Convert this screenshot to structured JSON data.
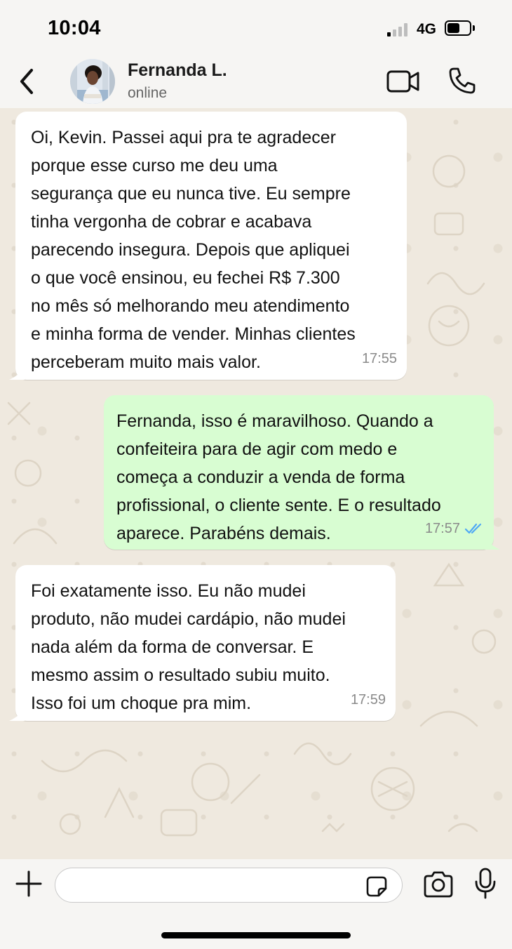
{
  "status_bar": {
    "time": "10:04",
    "network": "4G",
    "battery_level": 0.55
  },
  "header": {
    "contact_name": "Fernanda L.",
    "contact_status": "online",
    "icons": [
      "back-icon",
      "avatar-photo",
      "video-call-icon",
      "phone-icon"
    ]
  },
  "messages": [
    {
      "direction": "incoming",
      "text": "Oi, Kevin. Passei aqui pra te agradecer\nporque esse curso me deu uma\nsegurança que eu nunca tive. Eu sempre\ntinha vergonha de cobrar e acabava\nparecendo insegura. Depois que apliquei\no que você ensinou, eu fechei R$ 7.300\nno mês só melhorando meu atendimento\ne minha forma de vender. Minhas clientes\nperceberam muito mais valor.",
      "time": "17:55"
    },
    {
      "direction": "outgoing",
      "text": "Fernanda, isso é maravilhoso. Quando a\nconfeiteira para de agir com medo e\ncomeça a conduzir a venda de forma\nprofissional, o cliente sente. E o resultado\naparece. Parabéns demais.",
      "time": "17:57",
      "status": "read"
    },
    {
      "direction": "incoming",
      "text": "Foi exatamente isso. Eu não mudei\nproduto, não mudei cardápio, não mudei\nnada além da forma de conversar. E\nmesmo assim o resultado subiu muito.\nIsso foi um choque pra mim.",
      "time": "17:59"
    }
  ],
  "input_bar": {
    "placeholder": "",
    "value": "",
    "icons": [
      "plus-icon",
      "sticker-icon",
      "camera-icon",
      "microphone-icon"
    ]
  },
  "colors": {
    "incoming_bubble": "#ffffff",
    "outgoing_bubble": "#d8fdd2",
    "read_ticks": "#4fa8f5",
    "chat_background": "#efe9df"
  }
}
